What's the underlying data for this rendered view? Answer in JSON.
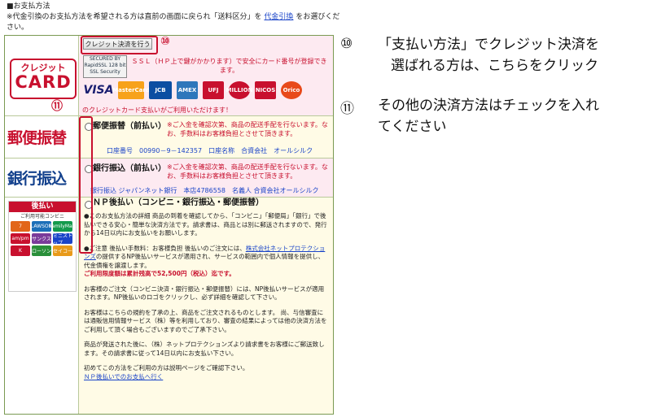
{
  "header": {
    "title": "■お支払方法",
    "note_prefix": "※代金引換のお支払方法を希望される方は直前の画面に戻られ「送料区分」を",
    "note_link": "代金引換",
    "note_suffix": "をお選びください。"
  },
  "credit": {
    "button_label": "クレジット決済を行う",
    "logo_line1": "クレジット",
    "logo_line2": "CARD",
    "seal_text": "SECURED BY RapidSSL 128 bit SSL Security",
    "ssl_text": "ＳＳＬ（ＨＰ上で鍵がかかります）で安全にカード番号が登録できます。",
    "brands": [
      "VISA",
      "MasterCard",
      "JCB",
      "AMEX",
      "UFJ",
      "MILLION",
      "NICOS",
      "Orico"
    ],
    "note": "のクレジットカード支払いがご利用いただけます！"
  },
  "postal": {
    "logo": "郵便振替",
    "title": "郵便振替（前払い）",
    "note": "※ご入金を確認次第、商品の配送手配を行ないます。なお、手数料はお客様負担とさせて頂きます。",
    "account": "口座番号　00990－9－142357　口座名称　合資会社　オールシルク"
  },
  "bank": {
    "logo": "銀行振込",
    "title": "銀行振込（前払い）",
    "note": "※ご入金を確認次第、商品の配送手配を行ないます。なお、手数料はお客様負担とさせて頂きます。",
    "account": "銀行振込 ジャパンネット銀行　本店4786558　名義人 合資会社オールシルク"
  },
  "np": {
    "logo_head": "後払い",
    "logo_sub": "ご利用可能コンビニ",
    "stores": [
      "7",
      "LAWSON",
      "FamilyMart",
      "am/pm",
      "サンクス",
      "ミニストップ",
      "K",
      "ローソン",
      "セイコー"
    ],
    "title": "ＮＰ後払い（コンビニ・銀行振込・郵便振替）",
    "p1": "●このお支払方法の詳細 商品の到着を確認してから、「コンビニ」「郵便局」「銀行」で後払いできる安心・簡単な決済方法です。請求書は、商品とは別に郵送されますので、発行から14日以内にお支払いをお願いします。",
    "p2_a": "●ご注意 後払い手数料：お客様負担 後払いのご注文には、",
    "p2_link": "株式会社ネットプロテクションズ",
    "p2_b": "の提供するNP後払いサービスが適用され、サービスの範囲内で個人情報を提供し、代金債権を譲渡します。",
    "p2_limit": "ご利用限度額は累計残高で52,500円（税込）迄です。",
    "p3": "お客様のご注文（コンビニ決済・銀行振込・郵便振替）には、NP後払いサービスが適用されます。NP後払いのロゴをクリックし、必ず詳細を確認して下さい。",
    "p4": "お客様はこちらの規約を了承の上、商品をご注文されるものとします。 尚、与信審査には通販信用情報サービス（株）等を利用しており、審査の結果によっては他の決済方法をご利用して頂く場合もございますのでご了承下さい。",
    "p5": "商品が発送された後に、（株）ネットプロテクションズより請求書をお客様にご郵送致します。その請求書に従って14日以内にお支払い下さい。",
    "p6": "初めてこの方法をご利用の方は説明ページをご確認下さい。",
    "p6_link": "ＮＰ後払いでのお支払へ行く"
  },
  "markers": {
    "m10": "⑩",
    "m11": "⑪"
  },
  "annotations": {
    "a10_num": "⑩",
    "a10_line1": "「支払い方法」でクレジット決済を",
    "a10_line2": "選ばれる方は、こちらをクリック",
    "a11_num": "⑪",
    "a11_line1": "その他の決済方法はチェックを入れ",
    "a11_line2": "てください"
  }
}
